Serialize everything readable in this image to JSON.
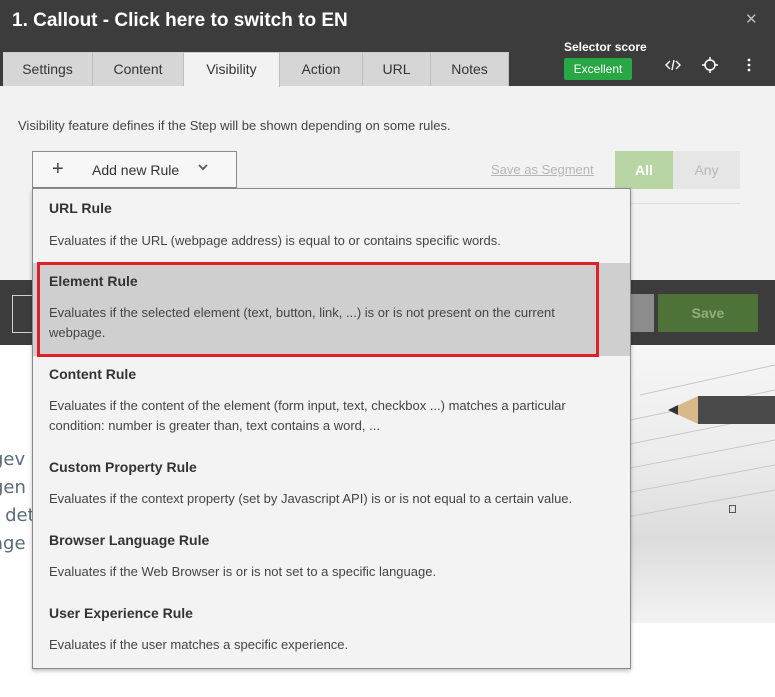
{
  "window": {
    "title": "1. Callout - Click here to switch to EN",
    "close_icon": "close-icon"
  },
  "tabs": [
    {
      "label": "Settings",
      "active": false
    },
    {
      "label": "Content",
      "active": false
    },
    {
      "label": "Visibility",
      "active": true
    },
    {
      "label": "Action",
      "active": false
    },
    {
      "label": "URL",
      "active": false
    },
    {
      "label": "Notes",
      "active": false
    }
  ],
  "selector": {
    "label": "Selector score",
    "badge": "Excellent",
    "badge_color": "#28a745"
  },
  "toolbar_icons": [
    "code-icon",
    "crosshair-icon",
    "kebab-menu-icon"
  ],
  "visibility": {
    "description": "Visibility feature defines if the Step will be shown depending on some rules.",
    "add_rule_label": "Add new Rule",
    "save_segment_label": "Save as Segment",
    "all_label": "All",
    "any_label": "Any"
  },
  "footer": {
    "save_label": "Save"
  },
  "dropdown": {
    "items": [
      {
        "name": "URL Rule",
        "desc": "Evaluates if the URL (webpage address) is equal to or contains specific words.",
        "highlighted": false
      },
      {
        "name": "Element Rule",
        "desc": "Evaluates if the selected element (text, button, link, ...) is or is not present on the current webpage.",
        "highlighted": true
      },
      {
        "name": "Content Rule",
        "desc": "Evaluates if the content of the element (form input, text, checkbox ...) matches a particular condition: number is greater than, text contains a word, ...",
        "highlighted": false
      },
      {
        "name": "Custom Property Rule",
        "desc": "Evaluates if the context property (set by Javascript API) is or is not equal to a certain value.",
        "highlighted": false
      },
      {
        "name": "Browser Language Rule",
        "desc": "Evaluates if the Web Browser is or is not set to a specific language.",
        "highlighted": false
      },
      {
        "name": "User Experience Rule",
        "desc": "Evaluates if the user matches a specific experience.",
        "highlighted": false
      }
    ]
  },
  "background": {
    "text_lines": [
      "gev",
      "gen",
      "r det",
      "age"
    ]
  },
  "colors": {
    "highlight_border": "#e01f26",
    "titlebar": "#3c3c3c",
    "save_bg": "#4d7339"
  }
}
